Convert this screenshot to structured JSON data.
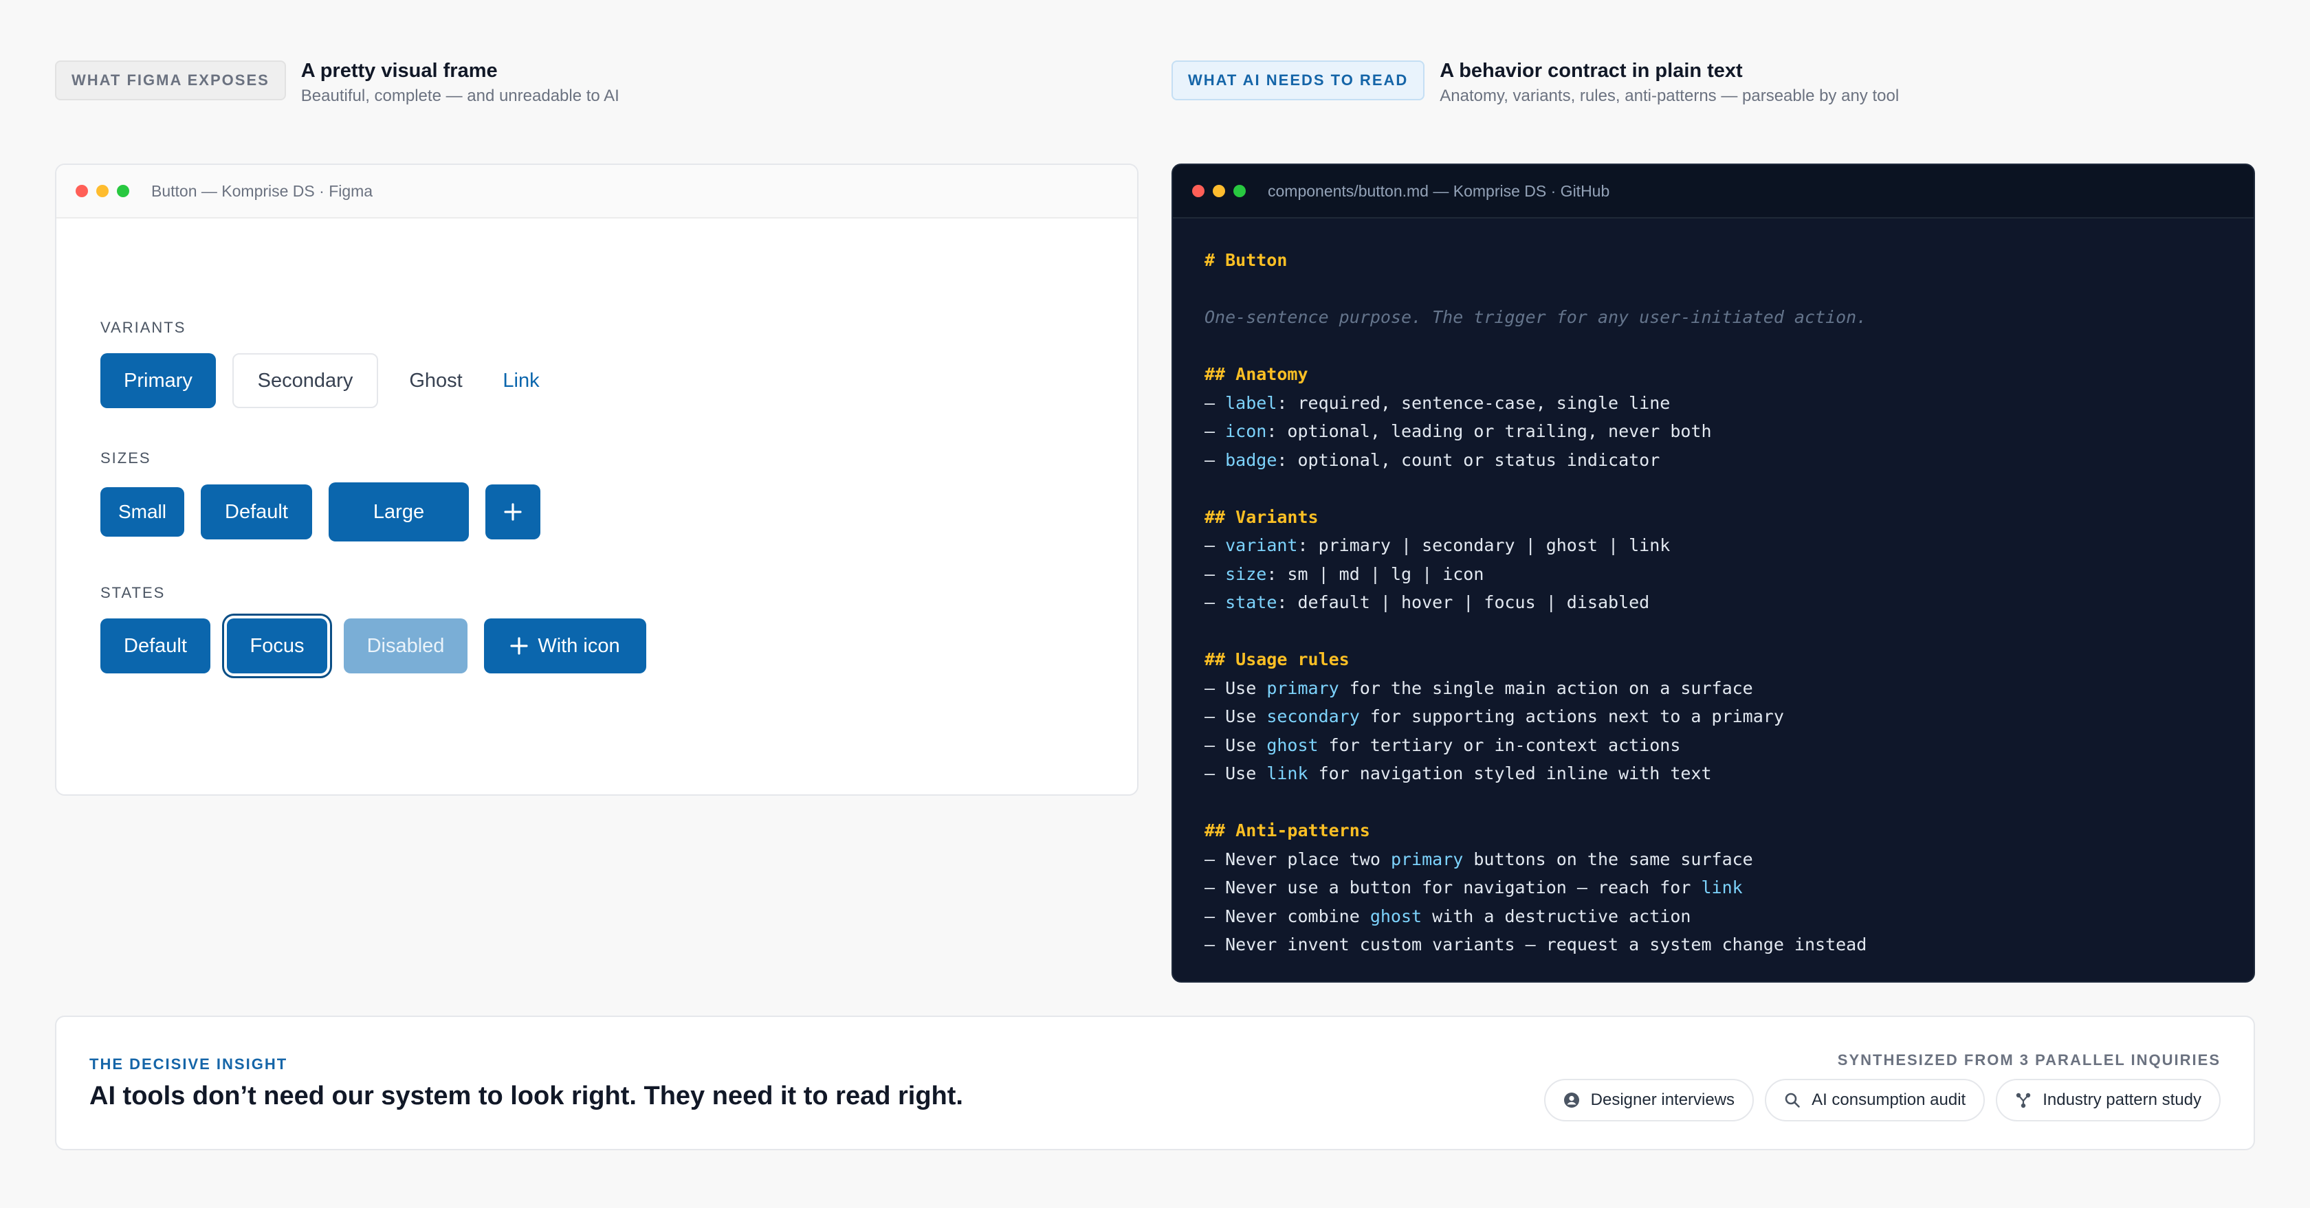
{
  "left_header": {
    "tag": "WHAT FIGMA EXPOSES",
    "title": "A pretty visual frame",
    "subtitle": "Beautiful, complete — and unreadable to AI"
  },
  "right_header": {
    "tag": "WHAT AI NEEDS TO READ",
    "title": "A behavior contract in plain text",
    "subtitle": "Anatomy, variants, rules, anti-patterns — parseable by any tool"
  },
  "figma_window": {
    "title": "Button — Komprise DS · Figma",
    "variants": {
      "label": "VARIANTS",
      "primary": "Primary",
      "secondary": "Secondary",
      "ghost": "Ghost",
      "link": "Link"
    },
    "sizes": {
      "label": "SIZES",
      "small": "Small",
      "default": "Default",
      "large": "Large",
      "icon": "plus-icon"
    },
    "states": {
      "label": "STATES",
      "default": "Default",
      "focus": "Focus",
      "disabled": "Disabled",
      "with_icon": "With icon"
    }
  },
  "code_window": {
    "title": "components/button.md — Komprise DS · GitHub",
    "lines": [
      [
        [
          "h",
          "# Button"
        ]
      ],
      [],
      [
        [
          "c",
          "One-sentence purpose. The trigger for any user-initiated action."
        ]
      ],
      [],
      [
        [
          "h",
          "## Anatomy"
        ]
      ],
      [
        [
          "t",
          "– "
        ],
        [
          "k",
          "label"
        ],
        [
          "t",
          ": required, sentence-case, single line"
        ]
      ],
      [
        [
          "t",
          "– "
        ],
        [
          "k",
          "icon"
        ],
        [
          "t",
          ": optional, leading or trailing, never both"
        ]
      ],
      [
        [
          "t",
          "– "
        ],
        [
          "k",
          "badge"
        ],
        [
          "t",
          ": optional, count or status indicator"
        ]
      ],
      [],
      [
        [
          "h",
          "## Variants"
        ]
      ],
      [
        [
          "t",
          "– "
        ],
        [
          "k",
          "variant"
        ],
        [
          "t",
          ": primary | secondary | ghost | link"
        ]
      ],
      [
        [
          "t",
          "– "
        ],
        [
          "k",
          "size"
        ],
        [
          "t",
          ": sm | md | lg | icon"
        ]
      ],
      [
        [
          "t",
          "– "
        ],
        [
          "k",
          "state"
        ],
        [
          "t",
          ": default | hover | focus | disabled"
        ]
      ],
      [],
      [
        [
          "h",
          "## Usage rules"
        ]
      ],
      [
        [
          "t",
          "– Use "
        ],
        [
          "k",
          "primary"
        ],
        [
          "t",
          " for the single main action on a surface"
        ]
      ],
      [
        [
          "t",
          "– Use "
        ],
        [
          "k",
          "secondary"
        ],
        [
          "t",
          " for supporting actions next to a primary"
        ]
      ],
      [
        [
          "t",
          "– Use "
        ],
        [
          "k",
          "ghost"
        ],
        [
          "t",
          " for tertiary or in-context actions"
        ]
      ],
      [
        [
          "t",
          "– Use "
        ],
        [
          "k",
          "link"
        ],
        [
          "t",
          " for navigation styled inline with text"
        ]
      ],
      [],
      [
        [
          "h",
          "## Anti-patterns"
        ]
      ],
      [
        [
          "t",
          "– Never place two "
        ],
        [
          "k",
          "primary"
        ],
        [
          "t",
          " buttons on the same surface"
        ]
      ],
      [
        [
          "t",
          "– Never use a button for navigation — reach for "
        ],
        [
          "k",
          "link"
        ]
      ],
      [
        [
          "t",
          "– Never combine "
        ],
        [
          "k",
          "ghost"
        ],
        [
          "t",
          " with a destructive action"
        ]
      ],
      [
        [
          "t",
          "– Never invent custom variants — request a system change instead"
        ]
      ]
    ]
  },
  "insight": {
    "eyebrow": "THE DECISIVE INSIGHT",
    "headline": "AI tools don’t need our system to look right. They need it to read right.",
    "synth_label": "SYNTHESIZED FROM 3 PARALLEL INQUIRIES",
    "chips": [
      {
        "label": "Designer interviews",
        "icon": "user-circle-icon"
      },
      {
        "label": "AI consumption audit",
        "icon": "search-icon"
      },
      {
        "label": "Industry pattern study",
        "icon": "network-icon"
      }
    ]
  },
  "colors": {
    "brand": "#0b66ad",
    "code_bg": "#0f172a",
    "code_heading": "#fbbf24",
    "code_keyword": "#7dd3fc"
  }
}
